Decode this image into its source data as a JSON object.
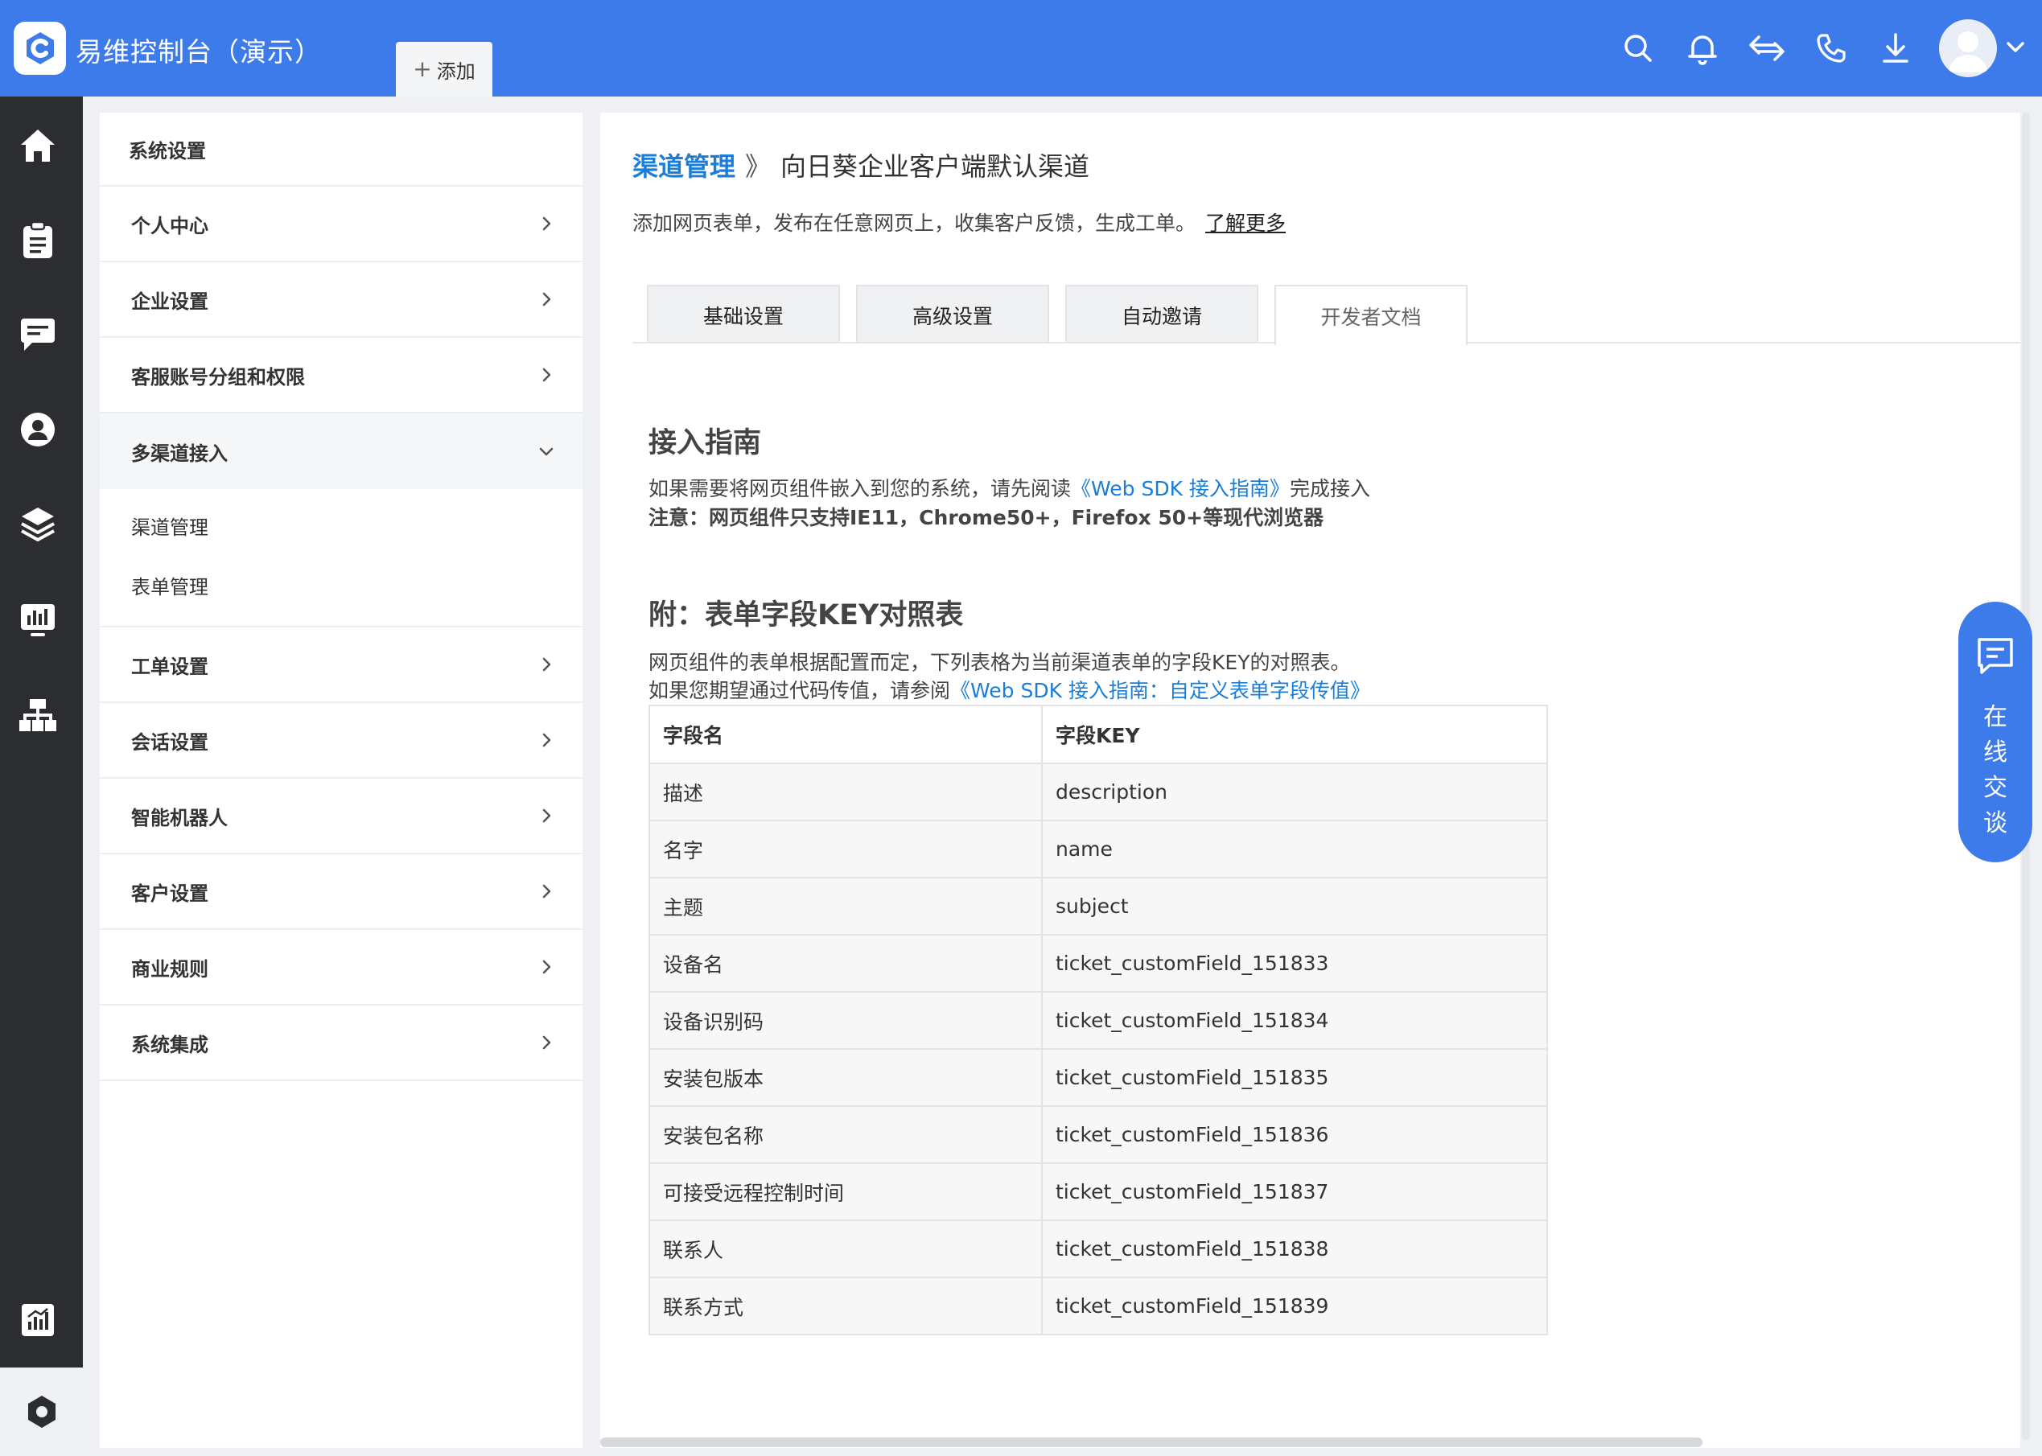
{
  "header": {
    "app_title": "易维控制台（演示）",
    "add_tab_label": "添加",
    "icons": [
      "search-icon",
      "bell-icon",
      "transfer-icon",
      "phone-icon",
      "download-icon",
      "avatar",
      "chevron-down-icon"
    ],
    "bar_color": "#3d7bea"
  },
  "rail": {
    "icons": [
      "home-icon",
      "clipboard-icon",
      "chat-icon",
      "user-icon",
      "layers-icon",
      "monitor-chart-icon",
      "org-chart-icon",
      "report-icon",
      "settings-hex-icon"
    ],
    "bg_color": "#2c2d30"
  },
  "settings_menu": {
    "header": "系统设置",
    "items": [
      {
        "label": "个人中心"
      },
      {
        "label": "企业设置"
      },
      {
        "label": "客服账号分组和权限"
      },
      {
        "label": "多渠道接入"
      },
      {
        "label": "工单设置"
      },
      {
        "label": "会话设置"
      },
      {
        "label": "智能机器人"
      },
      {
        "label": "客户设置"
      },
      {
        "label": "商业规则"
      },
      {
        "label": "系统集成"
      }
    ],
    "submenu": [
      {
        "label": "渠道管理"
      },
      {
        "label": "表单管理"
      }
    ]
  },
  "main": {
    "breadcrumb": {
      "parent": "渠道管理",
      "separator": "》",
      "current": "向日葵企业客户端默认渠道"
    },
    "intro": "添加网页表单，发布在任意网页上，收集客户反馈，生成工单。",
    "learn_more": "了解更多",
    "tabs": [
      {
        "label": "基础设置"
      },
      {
        "label": "高级设置"
      },
      {
        "label": "自动邀请"
      },
      {
        "label": "开发者文档"
      }
    ],
    "guide": {
      "title": "接入指南",
      "line1_prefix": "如果需要将网页组件嵌入到您的系统，请先阅读",
      "line1_link": "《Web SDK 接入指南》",
      "line1_suffix": "完成接入",
      "note": "注意：网页组件只支持IE11，Chrome50+，Firefox 50+等现代浏览器"
    },
    "appendix": {
      "title": "附：表单字段KEY对照表",
      "line1": "网页组件的表单根据配置而定，下列表格为当前渠道表单的字段KEY的对照表。",
      "line2_prefix": "如果您期望通过代码传值，请参阅",
      "line2_link": "《Web SDK 接入指南：自定义表单字段传值》"
    },
    "table": {
      "headers": [
        "字段名",
        "字段KEY"
      ],
      "rows": [
        [
          "描述",
          "description"
        ],
        [
          "名字",
          "name"
        ],
        [
          "主题",
          "subject"
        ],
        [
          "设备名",
          "ticket_customField_151833"
        ],
        [
          "设备识别码",
          "ticket_customField_151834"
        ],
        [
          "安装包版本",
          "ticket_customField_151835"
        ],
        [
          "安装包名称",
          "ticket_customField_151836"
        ],
        [
          "可接受远程控制时间",
          "ticket_customField_151837"
        ],
        [
          "联系人",
          "ticket_customField_151838"
        ],
        [
          "联系方式",
          "ticket_customField_151839"
        ]
      ]
    }
  },
  "chat_float": {
    "label": "在线交谈",
    "icon": "message-icon",
    "color": "#3d7bea"
  },
  "colors": {
    "link": "#1a7ed8",
    "accent": "#3d7bea"
  }
}
